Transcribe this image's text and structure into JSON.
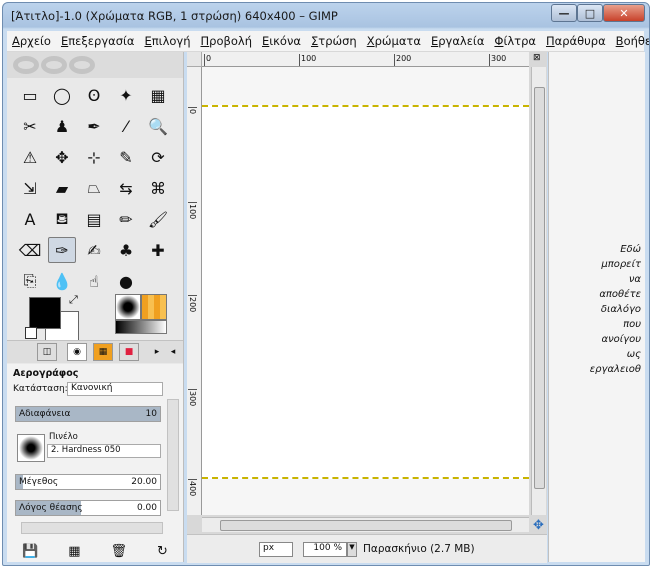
{
  "window": {
    "title": "[Άτιτλο]-1.0 (Χρώματα RGB, 1 στρώση) 640x400 – GIMP",
    "controls": {
      "minimize": "—",
      "maximize": "□",
      "close": "✕"
    }
  },
  "menubar": {
    "items": [
      "Αρχείο",
      "Επεξεργασία",
      "Επιλογή",
      "Προβολή",
      "Εικόνα",
      "Στρώση",
      "Χρώματα",
      "Εργαλεία",
      "Φίλτρα",
      "Παράθυρα",
      "Βοήθεια"
    ]
  },
  "toolbox": {
    "tools": [
      {
        "name": "rect-select-icon",
        "glyph": "▭"
      },
      {
        "name": "ellipse-select-icon",
        "glyph": "◯"
      },
      {
        "name": "lasso-icon",
        "glyph": "ʘ"
      },
      {
        "name": "fuzzy-select-icon",
        "glyph": "✦"
      },
      {
        "name": "color-select-icon",
        "glyph": "▦"
      },
      {
        "name": "scissors-icon",
        "glyph": "✂"
      },
      {
        "name": "foreground-select-icon",
        "glyph": "♟"
      },
      {
        "name": "paths-icon",
        "glyph": "✒"
      },
      {
        "name": "color-picker-icon",
        "glyph": "⁄"
      },
      {
        "name": "zoom-icon",
        "glyph": "🔍"
      },
      {
        "name": "measure-icon",
        "glyph": "⚠"
      },
      {
        "name": "move-icon",
        "glyph": "✥"
      },
      {
        "name": "align-icon",
        "glyph": "⊹"
      },
      {
        "name": "crop-icon",
        "glyph": "✎"
      },
      {
        "name": "rotate-icon",
        "glyph": "⟳"
      },
      {
        "name": "scale-icon",
        "glyph": "⇲"
      },
      {
        "name": "shear-icon",
        "glyph": "▰"
      },
      {
        "name": "perspective-icon",
        "glyph": "⏢"
      },
      {
        "name": "flip-icon",
        "glyph": "⇆"
      },
      {
        "name": "cage-icon",
        "glyph": "⌘"
      },
      {
        "name": "text-icon",
        "glyph": "A"
      },
      {
        "name": "bucket-fill-icon",
        "glyph": "⛾"
      },
      {
        "name": "blend-icon",
        "glyph": "▤"
      },
      {
        "name": "pencil-icon",
        "glyph": "✏"
      },
      {
        "name": "paintbrush-icon",
        "glyph": "🖌"
      },
      {
        "name": "eraser-icon",
        "glyph": "⌫"
      },
      {
        "name": "airbrush-icon",
        "glyph": "✑"
      },
      {
        "name": "ink-icon",
        "glyph": "✍"
      },
      {
        "name": "clone-icon",
        "glyph": "♣"
      },
      {
        "name": "heal-icon",
        "glyph": "✚"
      },
      {
        "name": "perspective-clone-icon",
        "glyph": "⎘"
      },
      {
        "name": "blur-icon",
        "glyph": "💧"
      },
      {
        "name": "smudge-icon",
        "glyph": "☝"
      },
      {
        "name": "dodge-burn-icon",
        "glyph": "●"
      }
    ],
    "selected_tool": 26,
    "colors": {
      "foreground": "#000000",
      "background": "#ffffff",
      "pattern_accent": "#f0a020"
    },
    "tabs": [
      "◫",
      "◉",
      "▦",
      "■"
    ],
    "tab_arrow": "▸",
    "tab_menu": "◂"
  },
  "tool_options": {
    "title": "Αερογράφος",
    "mode_label": "Κατάσταση:",
    "mode_value": "Κανονική",
    "opacity_label": "Αδιαφάνεια",
    "opacity_value": "10",
    "opacity_fraction": 1.0,
    "brush_label": "Πινέλο",
    "brush_name": "2. Hardness 050",
    "size_label": "Μέγεθος",
    "size_value": "20.00",
    "size_fraction": 0.05,
    "aspect_label": "Λόγος θέασης",
    "aspect_value": "0.00",
    "aspect_fraction": 0.45,
    "bottom_buttons": [
      "💾",
      "▦",
      "🗑",
      "↻"
    ]
  },
  "image_window": {
    "ruler_top_labels": [
      "0",
      "100",
      "200",
      "300"
    ],
    "ruler_left_labels": [
      "0",
      "100",
      "200",
      "300",
      "400"
    ],
    "zoom_corner_icon": "⊠",
    "status": {
      "unit": "px",
      "zoom": "100 %",
      "layer_info": "Παρασκήνιο (2.7 MB)"
    },
    "nav_icon": "✥"
  },
  "dock": {
    "lines": [
      "Εδώ",
      "μπορείτ",
      "να",
      "αποθέτε",
      "διαλόγο",
      "που",
      "ανοίγου",
      "ως",
      "εργαλειοθ"
    ]
  }
}
